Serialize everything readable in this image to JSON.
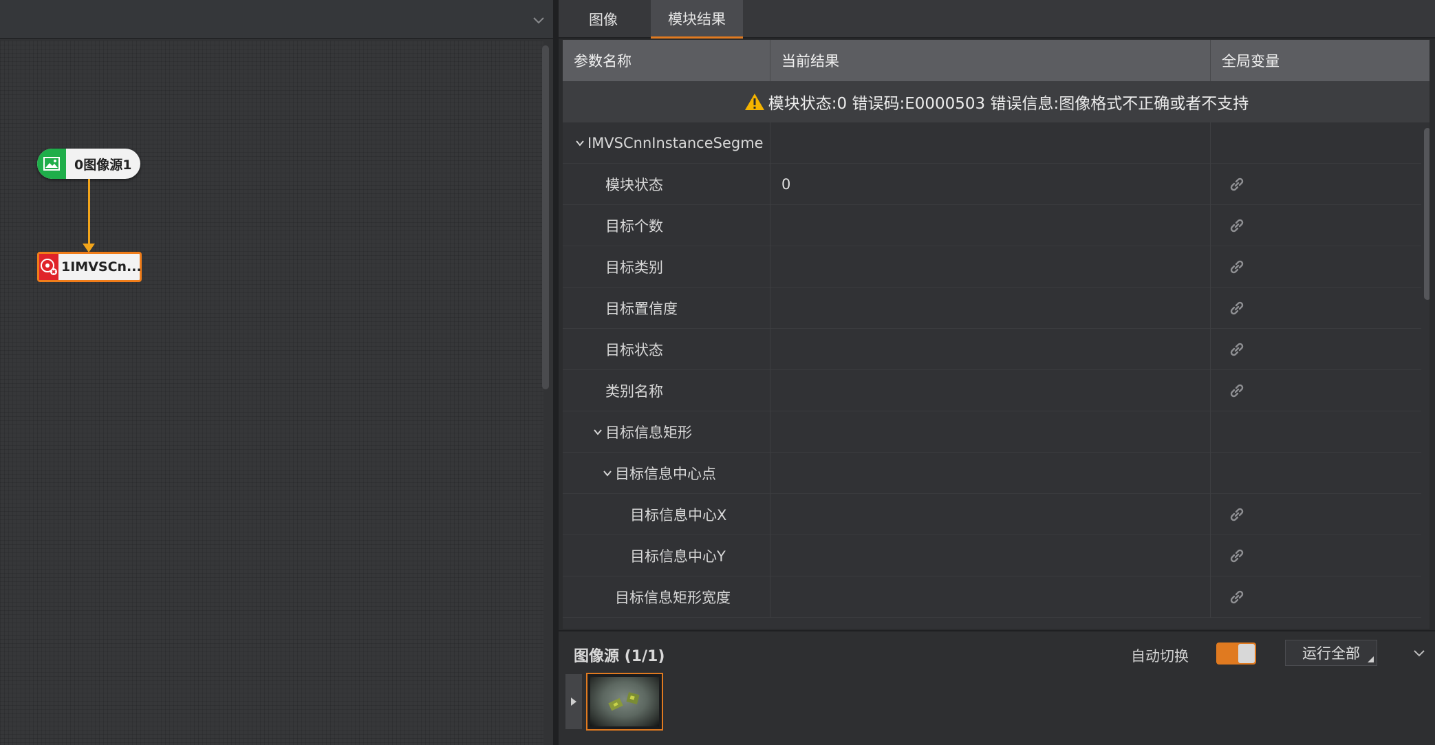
{
  "flow": {
    "nodes": [
      {
        "label": "0图像源1",
        "icon": "image-icon",
        "color": "#1fae4a"
      },
      {
        "label": "1IMVSCn...",
        "icon": "cnn-module-icon",
        "color": "#e0232a",
        "status": "error"
      }
    ],
    "connector_color": "#f2a51b"
  },
  "tabs": [
    {
      "label": "图像"
    },
    {
      "label": "模块结果",
      "active": true
    }
  ],
  "grid": {
    "headers": [
      "参数名称",
      "当前结果",
      "全局变量"
    ],
    "error_message": "模块状态:0 错误码:E0000503 错误信息:图像格式不正确或者不支持",
    "rows": [
      {
        "name": "IMVSCnnInstanceSegme",
        "value": "",
        "indent": 0,
        "collapsible": true,
        "link": false
      },
      {
        "name": "模块状态",
        "value": "0",
        "indent": 1,
        "collapsible": false,
        "link": true
      },
      {
        "name": "目标个数",
        "value": "",
        "indent": 1,
        "collapsible": false,
        "link": true
      },
      {
        "name": "目标类别",
        "value": "",
        "indent": 1,
        "collapsible": false,
        "link": true
      },
      {
        "name": "目标置信度",
        "value": "",
        "indent": 1,
        "collapsible": false,
        "link": true
      },
      {
        "name": "目标状态",
        "value": "",
        "indent": 1,
        "collapsible": false,
        "link": true
      },
      {
        "name": "类别名称",
        "value": "",
        "indent": 1,
        "collapsible": false,
        "link": true
      },
      {
        "name": "目标信息矩形",
        "value": "",
        "indent": 1,
        "collapsible": true,
        "link": false
      },
      {
        "name": "目标信息中心点",
        "value": "",
        "indent": 2,
        "collapsible": true,
        "link": false
      },
      {
        "name": "目标信息中心X",
        "value": "",
        "indent": 3,
        "collapsible": false,
        "link": true
      },
      {
        "name": "目标信息中心Y",
        "value": "",
        "indent": 3,
        "collapsible": false,
        "link": true
      },
      {
        "name": "目标信息矩形宽度",
        "value": "",
        "indent": 2,
        "collapsible": false,
        "link": true
      }
    ]
  },
  "image_source": {
    "title": "图像源 (1/1)",
    "auto_switch_label": "自动切换",
    "auto_switch_on": true,
    "run_all_label": "运行全部"
  },
  "colors": {
    "accent": "#e07a20",
    "warning": "#f5b400"
  }
}
